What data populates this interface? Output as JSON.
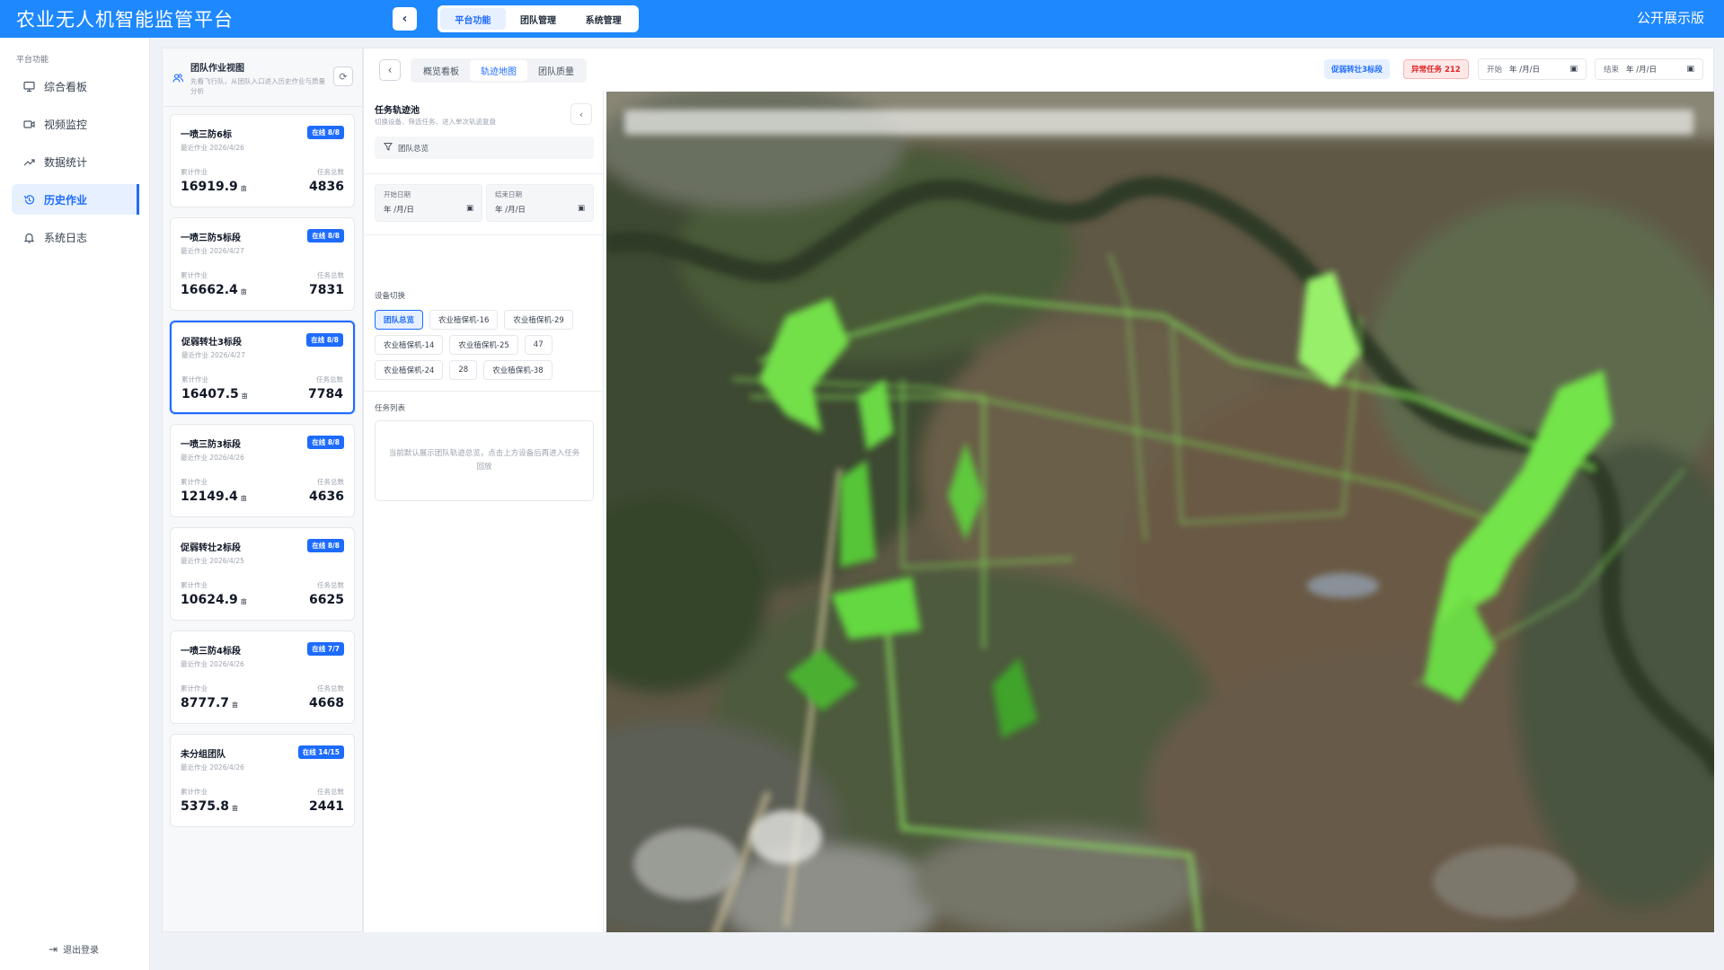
{
  "header": {
    "app_title": "农业无人机智能监管平台",
    "back_icon": "chevron-left-icon",
    "tabs": [
      {
        "label": "平台功能",
        "active": true
      },
      {
        "label": "团队管理",
        "active": false
      },
      {
        "label": "系统管理",
        "active": false
      }
    ],
    "edition_label": "公开展示版",
    "brand_color": "#1e88ff"
  },
  "sidebar": {
    "section_label": "平台功能",
    "items": [
      {
        "label": "综合看板",
        "icon": "monitor-icon",
        "active": false
      },
      {
        "label": "视频监控",
        "icon": "video-icon",
        "active": false
      },
      {
        "label": "数据统计",
        "icon": "trend-icon",
        "active": false
      },
      {
        "label": "历史作业",
        "icon": "history-icon",
        "active": true
      },
      {
        "label": "系统日志",
        "icon": "bell-icon",
        "active": false
      }
    ],
    "logout_label": "退出登录"
  },
  "team_panel": {
    "title": "团队作业视图",
    "subtitle": "先看飞行队，从团队入口进入历史作业与质量分析",
    "accumulated_label": "累计作业",
    "task_total_label": "任务总数",
    "unit_label": "亩",
    "teams": [
      {
        "name": "一喷三防6标",
        "date": "最近作业 2026/4/26",
        "badge": "在线 8/8",
        "area": "16919.9",
        "tasks": "4836",
        "selected": false
      },
      {
        "name": "一喷三防5标段",
        "date": "最近作业 2026/4/27",
        "badge": "在线 8/8",
        "area": "16662.4",
        "tasks": "7831",
        "selected": false
      },
      {
        "name": "促弱转壮3标段",
        "date": "最近作业 2026/4/27",
        "badge": "在线 8/8",
        "area": "16407.5",
        "tasks": "7784",
        "selected": true
      },
      {
        "name": "一喷三防3标段",
        "date": "最近作业 2026/4/26",
        "badge": "在线 8/8",
        "area": "12149.4",
        "tasks": "4636",
        "selected": false
      },
      {
        "name": "促弱转壮2标段",
        "date": "最近作业 2026/4/25",
        "badge": "在线 8/8",
        "area": "10624.9",
        "tasks": "6625",
        "selected": false
      },
      {
        "name": "一喷三防4标段",
        "date": "最近作业 2026/4/26",
        "badge": "在线 7/7",
        "area": "8777.7",
        "tasks": "4668",
        "selected": false
      },
      {
        "name": "未分组团队",
        "date": "最近作业 2026/4/26",
        "badge": "在线 14/15",
        "area": "5375.8",
        "tasks": "2441",
        "selected": false
      }
    ]
  },
  "main": {
    "sub_tabs": [
      {
        "label": "概览看板",
        "active": false
      },
      {
        "label": "轨迹地图",
        "active": true
      },
      {
        "label": "团队质量",
        "active": false
      }
    ],
    "current_team_chip": "促弱转壮3标段",
    "abnormal_chip": "异常任务 212",
    "start_label": "开始",
    "end_label": "结束",
    "date_placeholder": "年 /月/日"
  },
  "pool": {
    "title": "任务轨迹池",
    "subtitle": "切换设备、筛选任务、进入单次轨迹复盘",
    "filter_label": "团队总览",
    "start_date_label": "开始日期",
    "end_date_label": "结束日期",
    "date_placeholder": "年 /月/日",
    "device_section_label": "设备切换",
    "devices": [
      {
        "label": "团队总览",
        "active": true
      },
      {
        "label": "农业植保机-16",
        "active": false
      },
      {
        "label": "农业植保机-29",
        "active": false
      },
      {
        "label": "农业植保机-14",
        "active": false
      },
      {
        "label": "农业植保机-25",
        "active": false
      },
      {
        "label": "47",
        "active": false
      },
      {
        "label": "农业植保机-24",
        "active": false
      },
      {
        "label": "28",
        "active": false
      },
      {
        "label": "农业植保机-38",
        "active": false
      }
    ],
    "task_section_label": "任务列表",
    "empty_text": "当前默认展示团队轨迹总览，点击上方设备后再进入任务回放"
  },
  "colors": {
    "accent": "#1e6bff",
    "danger": "#e02424",
    "track_green": "#6ee043"
  }
}
